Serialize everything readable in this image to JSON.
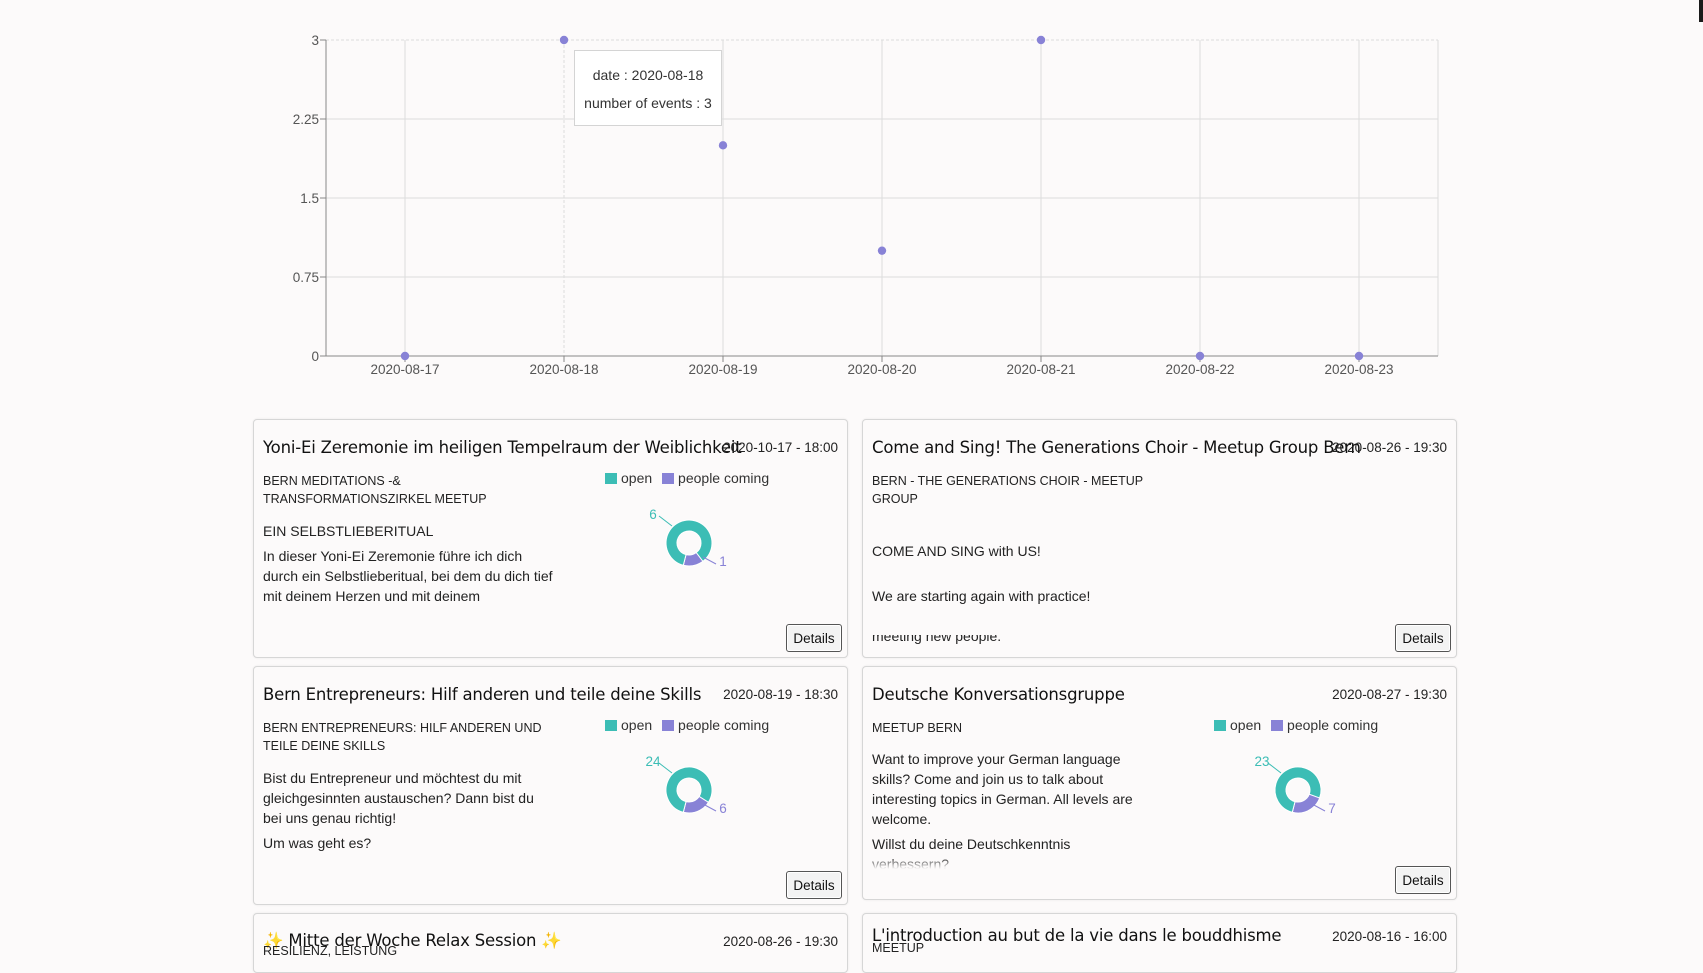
{
  "chart_data": {
    "type": "scatter",
    "x": [
      "2020-08-17",
      "2020-08-18",
      "2020-08-19",
      "2020-08-20",
      "2020-08-21",
      "2020-08-22",
      "2020-08-23"
    ],
    "values": [
      0,
      3,
      2,
      1,
      3,
      0,
      0
    ],
    "yticks": [
      "0",
      "0.75",
      "1.5",
      "2.25",
      "3"
    ],
    "ylim": [
      0,
      3
    ],
    "grid": true,
    "color": "#8882d6",
    "tooltip": {
      "line1": "date : 2020-08-18",
      "line2": "number of events : 3"
    }
  },
  "colors": {
    "open": "#3cbdb5",
    "coming": "#8882d6"
  },
  "cards": [
    {
      "title": "Yoni-Ei Zeremonie im heiligen Tempelraum der Weiblichkeit",
      "date": "2020-10-17 - 18:00",
      "group": "BERN MEDITATIONS -& TRANSFORMATIONSZIRKEL MEETUP",
      "desc": [
        "EIN SELBSTLIEBERITUAL",
        "In dieser Yoni-Ei Zeremonie führe ich dich durch ein Selbstliebe­ritual, bei dem du dich tief mit deinem Herzen und mit deinem"
      ],
      "legend_open": "open",
      "legend_coming": "people coming",
      "open": 6,
      "coming": 1,
      "open_label": "6",
      "coming_label": "1",
      "button": "Details"
    },
    {
      "title": "Come and Sing! The Generations Choir - Meetup Group Bern",
      "date": "2020-08-26 - 19:30",
      "group": "BERN - THE GENERATIONS CHOIR - MEETUP GROUP",
      "desc": [
        "COME AND SING with US!",
        "We are starting again with practice!\nOur goal is, we want to enjoy a fun evening with great music, singing, exchanging and meeting new people."
      ],
      "button": "Details"
    },
    {
      "title": "Bern Entrepreneurs: Hilf anderen und teile deine Skills",
      "date": "2020-08-19 - 18:30",
      "group": "BERN ENTREPRENEURS: HILF ANDEREN UND TEILE DEINE SKILLS",
      "desc": [
        "Bist du Entrepreneur und möchtest du mit gleichgesinnten austauschen? Dann bist du bei uns genau richtig!",
        "Um was geht es?"
      ],
      "legend_open": "open",
      "legend_coming": "people coming",
      "open": 24,
      "coming": 6,
      "open_label": "24",
      "coming_label": "6",
      "button": "Details"
    },
    {
      "title": "Deutsche Konversationsgruppe",
      "date": "2020-08-27 - 19:30",
      "group": "MEETUP BERN",
      "desc": [
        "Want to improve your German language skills? Come and join us to talk about interesting topics in German. All levels are welcome.",
        "Willst du deine Deutschkenntnis verbessern?"
      ],
      "legend_open": "open",
      "legend_coming": "people coming",
      "open": 23,
      "coming": 7,
      "open_label": "23",
      "coming_label": "7",
      "button": "Details"
    },
    {
      "title": "✨ Mitte der Woche Relax Session ✨",
      "date": "2020-08-26 - 19:30",
      "group": "RESILIENZ, LEISTUNG"
    },
    {
      "title": "L'introduction au but de la vie dans le bouddhisme",
      "date": "2020-08-16 - 16:00",
      "group": "MEETUP"
    }
  ]
}
